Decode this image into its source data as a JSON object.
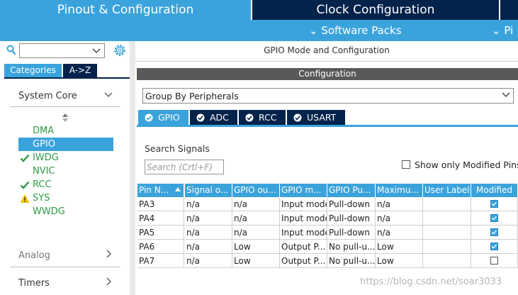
{
  "tabs": {
    "pinout": "Pinout & Configuration",
    "clock": "Clock Configuration"
  },
  "menu": {
    "software_packs": "⌄ Software Packs",
    "pinout_more": "⌄ Pi"
  },
  "sidebar": {
    "search_value": "",
    "categories_tab": "Categories",
    "az_tab": "A->Z",
    "system_core": "System Core",
    "peripherals": [
      {
        "label": "DMA",
        "status": "none"
      },
      {
        "label": "GPIO",
        "status": "selected"
      },
      {
        "label": "IWDG",
        "status": "check"
      },
      {
        "label": "NVIC",
        "status": "none"
      },
      {
        "label": "RCC",
        "status": "check"
      },
      {
        "label": "SYS",
        "status": "warning"
      },
      {
        "label": "WWDG",
        "status": "none"
      }
    ],
    "analog": "Analog",
    "timers": "Timers"
  },
  "main": {
    "title": "GPIO Mode and Configuration",
    "config_header": "Configuration",
    "group_by": "Group By Peripherals",
    "tabs": [
      "GPIO",
      "ADC",
      "RCC",
      "USART"
    ],
    "search_label": "Search Signals",
    "search_placeholder": "Search (Crtl+F)",
    "show_modified": "Show only Modified Pins",
    "table": {
      "headers": [
        "Pin N...",
        "Signal o...",
        "GPIO ou...",
        "GPIO m...",
        "GPIO Pu...",
        "Maximu...",
        "User Label",
        "Modified"
      ],
      "rows": [
        [
          "PA3",
          "n/a",
          "n/a",
          "Input mode",
          "Pull-down",
          "n/a",
          "",
          true
        ],
        [
          "PA4",
          "n/a",
          "n/a",
          "Input mode",
          "Pull-down",
          "n/a",
          "",
          true
        ],
        [
          "PA5",
          "n/a",
          "n/a",
          "Input mode",
          "Pull-down",
          "n/a",
          "",
          true
        ],
        [
          "PA6",
          "n/a",
          "Low",
          "Output P...",
          "No pull-u...",
          "Low",
          "",
          true
        ],
        [
          "PA7",
          "n/a",
          "Low",
          "Output P...",
          "No pull-u...",
          "Low",
          "",
          false
        ]
      ]
    }
  },
  "watermark": "https://blog.csdn.net/soar3033",
  "colors": {
    "accent": "#3ba3dc",
    "navy": "#03234b",
    "check_green": "#2e9a46",
    "warning_yellow": "#f2c500"
  }
}
